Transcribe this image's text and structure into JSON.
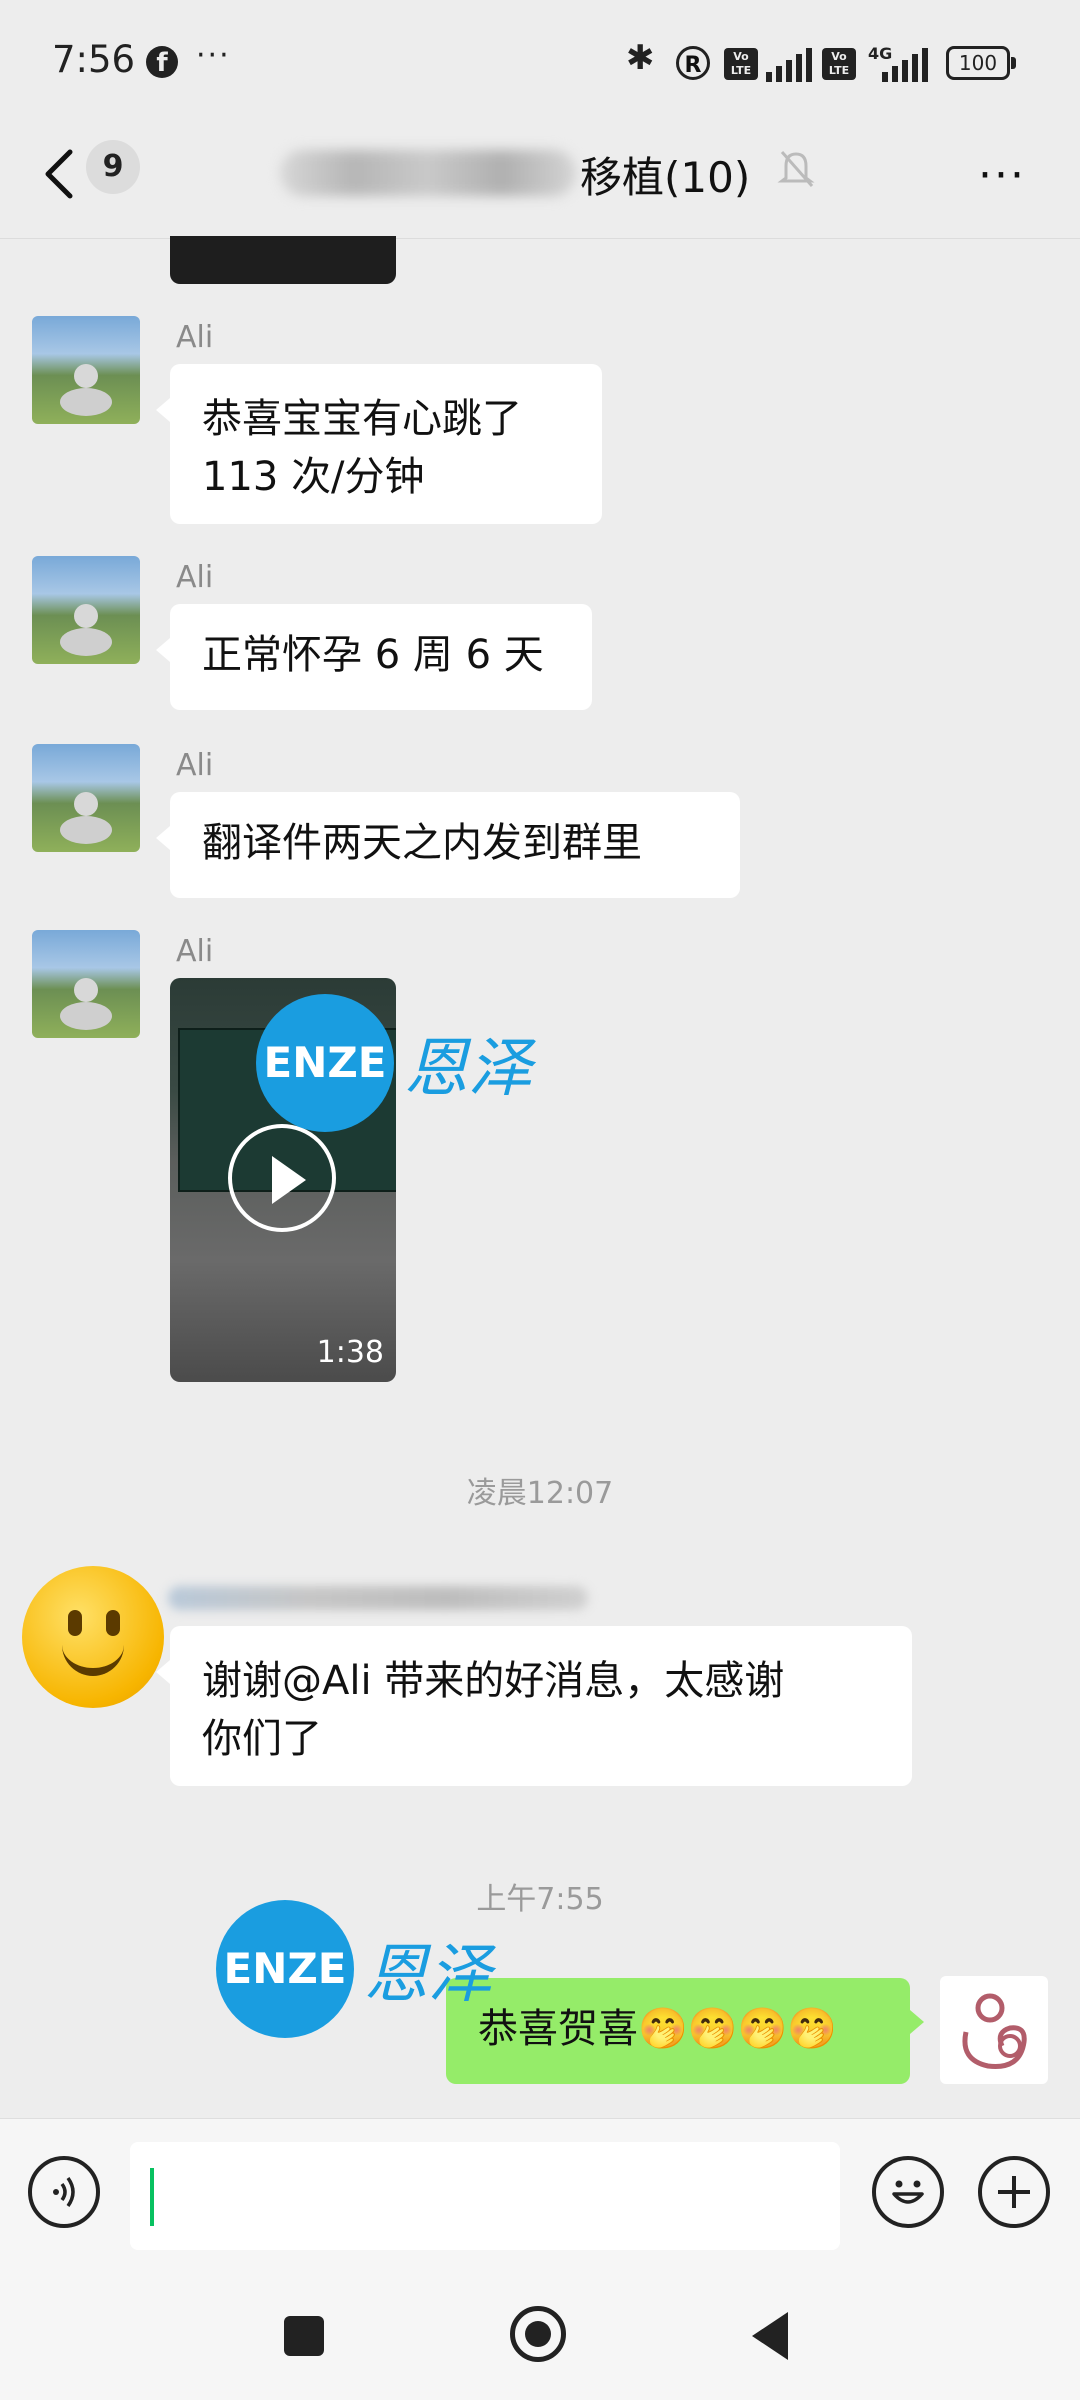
{
  "status_bar": {
    "time": "7:56",
    "facebook_glyph": "f",
    "more_glyph": "···",
    "registered_glyph": "R",
    "volte_label": "Vo LTE",
    "network": "4G",
    "battery": "100"
  },
  "nav": {
    "unread_count": "9",
    "title_visible": "移植(10)",
    "title_obscured": true,
    "muted": true
  },
  "messages": [
    {
      "sender": "Ali",
      "text_line1": "恭喜宝宝有心跳了",
      "text_line2": "113 次/分钟"
    },
    {
      "sender": "Ali",
      "text": "正常怀孕 6 周 6 天"
    },
    {
      "sender": "Ali",
      "text": "翻译件两天之内发到群里"
    },
    {
      "sender": "Ali",
      "type": "video",
      "duration": "1:38"
    }
  ],
  "timestamps": [
    "凌晨12:07",
    "上午7:55"
  ],
  "incoming_reply": {
    "text_line1": "谢谢@Ali  带来的好消息，太感谢",
    "text_line2": "你们了",
    "sender_obscured": true
  },
  "outgoing": {
    "text": "恭喜贺喜🤭🤭🤭🤭"
  },
  "watermark": {
    "circle_text": "ENZE",
    "brand_text": "恩泽",
    "color": "#1a9de0"
  },
  "colors": {
    "background": "#ededed",
    "outgoing_bubble": "#95ec69",
    "incoming_bubble": "#ffffff",
    "caret": "#07c160"
  },
  "icons": [
    "back-chevron-icon",
    "bell-muted-icon",
    "more-icon",
    "voice-icon",
    "emoji-icon",
    "plus-icon"
  ]
}
